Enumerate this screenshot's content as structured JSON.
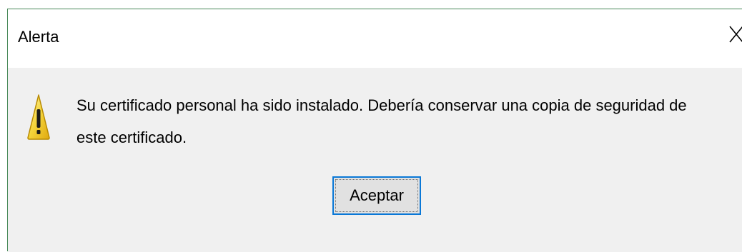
{
  "window": {
    "title": "Alerta",
    "close_icon": "close-icon"
  },
  "dialog": {
    "icon": "warning-icon",
    "message": "Su certificado personal ha sido instalado. Debería conservar una copia de seguridad de este certificado.",
    "ok_label": "Aceptar"
  },
  "colors": {
    "border": "#4a8a5a",
    "button_focus": "#0a78d7",
    "background": "#f0f0f0",
    "warning_fill": "#f2d027"
  }
}
